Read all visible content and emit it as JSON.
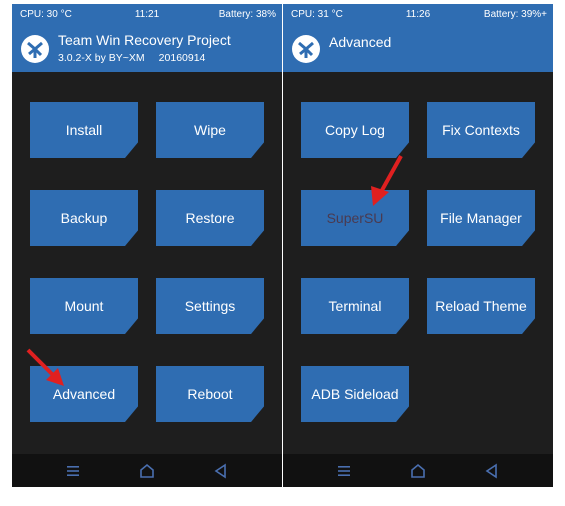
{
  "left_screen": {
    "status": {
      "cpu": "CPU: 30 °C",
      "time": "11:21",
      "battery": "Battery: 38%"
    },
    "header": {
      "title": "Team Win Recovery Project",
      "version": "3.0.2-X by BY~XM",
      "date": "20160914"
    },
    "buttons": [
      "Install",
      "Wipe",
      "Backup",
      "Restore",
      "Mount",
      "Settings",
      "Advanced",
      "Reboot"
    ]
  },
  "right_screen": {
    "status": {
      "cpu": "CPU: 31 °C",
      "time": "11:26",
      "battery": "Battery: 39%+"
    },
    "header": {
      "title": "Advanced"
    },
    "buttons": [
      "Copy Log",
      "Fix Contexts",
      "SuperSU",
      "File Manager",
      "Terminal",
      "Reload Theme",
      "ADB Sideload"
    ]
  },
  "navbar_icons": [
    "menu-icon",
    "home-icon",
    "back-icon"
  ],
  "annotation_arrows": [
    "red-arrow-to-advanced",
    "red-arrow-to-supersu"
  ],
  "colors": {
    "accent": "#2f6db2",
    "background": "#1e1e1e",
    "navbar": "#111111",
    "arrow": "#e02020"
  }
}
